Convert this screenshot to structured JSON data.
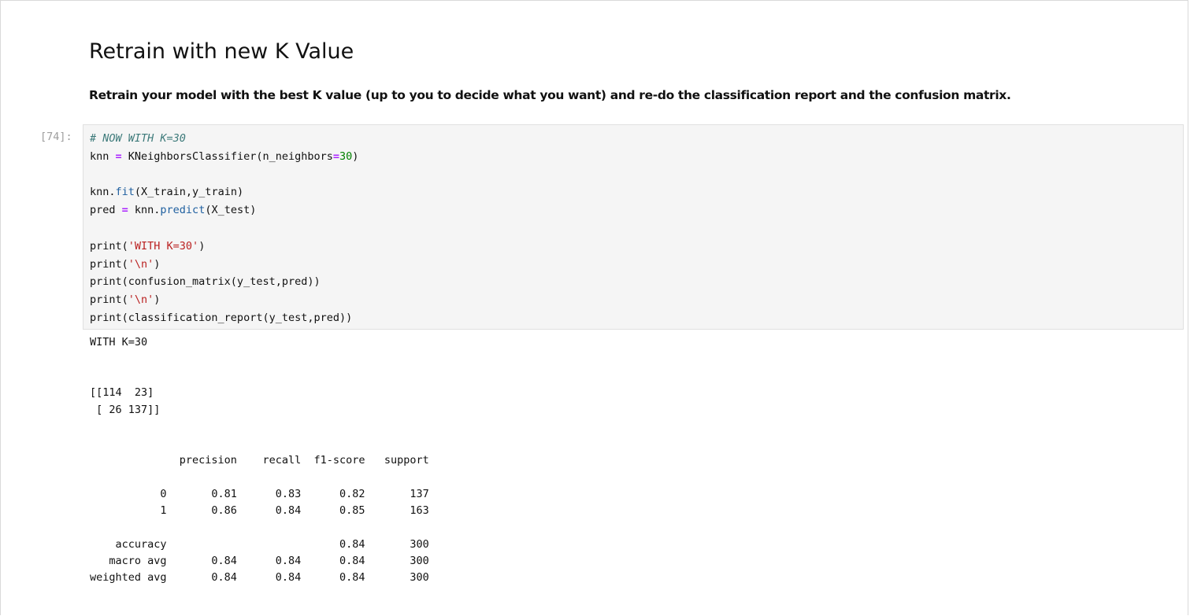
{
  "markdown": {
    "heading": "Retrain with new K Value",
    "instruction": "Retrain your model with the best K value (up to you to decide what you want) and re-do the classification report and the confusion matrix."
  },
  "cell": {
    "prompt": "[74]:",
    "code": [
      [
        {
          "t": "# NOW WITH K=30",
          "c": "comment"
        }
      ],
      [
        {
          "t": "knn "
        },
        {
          "t": "=",
          "c": "op"
        },
        {
          "t": " KNeighborsClassifier(n_neighbors"
        },
        {
          "t": "=",
          "c": "op"
        },
        {
          "t": "30",
          "c": "num"
        },
        {
          "t": ")"
        }
      ],
      [],
      [
        {
          "t": "knn."
        },
        {
          "t": "fit",
          "c": "prop"
        },
        {
          "t": "(X_train,y_train)"
        }
      ],
      [
        {
          "t": "pred "
        },
        {
          "t": "=",
          "c": "op"
        },
        {
          "t": " knn."
        },
        {
          "t": "predict",
          "c": "prop"
        },
        {
          "t": "(X_test)"
        }
      ],
      [],
      [
        {
          "t": "print("
        },
        {
          "t": "'WITH K=30'",
          "c": "str"
        },
        {
          "t": ")"
        }
      ],
      [
        {
          "t": "print("
        },
        {
          "t": "'\\n'",
          "c": "str"
        },
        {
          "t": ")"
        }
      ],
      [
        {
          "t": "print(confusion_matrix(y_test,pred))"
        }
      ],
      [
        {
          "t": "print("
        },
        {
          "t": "'\\n'",
          "c": "str"
        },
        {
          "t": ")"
        }
      ],
      [
        {
          "t": "print(classification_report(y_test,pred))"
        }
      ]
    ],
    "output": [
      "WITH K=30",
      "",
      "",
      "[[114  23]",
      " [ 26 137]]",
      "",
      "",
      "              precision    recall  f1-score   support",
      "",
      "           0       0.81      0.83      0.82       137",
      "           1       0.86      0.84      0.85       163",
      "",
      "    accuracy                           0.84       300",
      "   macro avg       0.84      0.84      0.84       300",
      "weighted avg       0.84      0.84      0.84       300"
    ]
  }
}
